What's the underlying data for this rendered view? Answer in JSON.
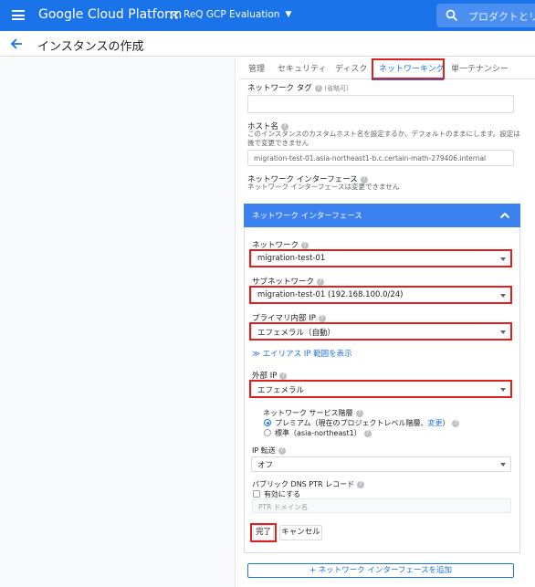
{
  "topbar": {
    "brand": "Google Cloud Platform",
    "project": "ReQ GCP Evaluation",
    "search_placeholder": "プロダクトとリ"
  },
  "header": {
    "title": "インスタンスの作成"
  },
  "tabs": [
    "管理",
    "セキュリティ",
    "ディスク",
    "ネットワーキング",
    "単一テナンシー"
  ],
  "active_tab": "ネットワーキング",
  "network_tags": {
    "label": "ネットワーク タグ",
    "optional": "(省略可)"
  },
  "hostname": {
    "label": "ホスト名",
    "desc1": "このインスタンスのカスタムホスト名を設定するか、デフォルトのままにします。設定は",
    "desc2": "後で変更できません",
    "value": "migration-test-01.asia-northeast1-b.c.certain-math-279406.internal"
  },
  "network_interfaces": {
    "label": "ネットワーク インターフェース",
    "desc": "ネットワーク インターフェースは変更できません"
  },
  "card": {
    "title": "ネットワーク インターフェース",
    "network_label": "ネットワーク",
    "network_value": "migration-test-01",
    "subnetwork_label": "サブネットワーク",
    "subnetwork_value": "migration-test-01 (192.168.100.0/24)",
    "primary_ip_label": "プライマリ内部 IP",
    "primary_ip_value": "エフェメラル（自動）",
    "alias_link": "エイリアス IP 範囲を表示",
    "external_ip_label": "外部 IP",
    "external_ip_value": "エフェメラル",
    "tier_label": "ネットワーク サービス階層",
    "tier_premium": "プレミアム（現在のプロジェクトレベル階層、",
    "tier_change": "変更",
    "tier_premium_end": "）",
    "tier_standard": "標準（asia-northeast1）",
    "ip_forward_label": "IP 転送",
    "ip_forward_value": "オフ",
    "ptr_label": "パブリック DNS PTR レコード",
    "ptr_enable": "有効にする",
    "ptr_placeholder": "PTR ドメイン名",
    "done_button": "完了",
    "cancel_button": "キャンセル"
  },
  "add_interface_button": "ネットワーク インターフェースを追加"
}
